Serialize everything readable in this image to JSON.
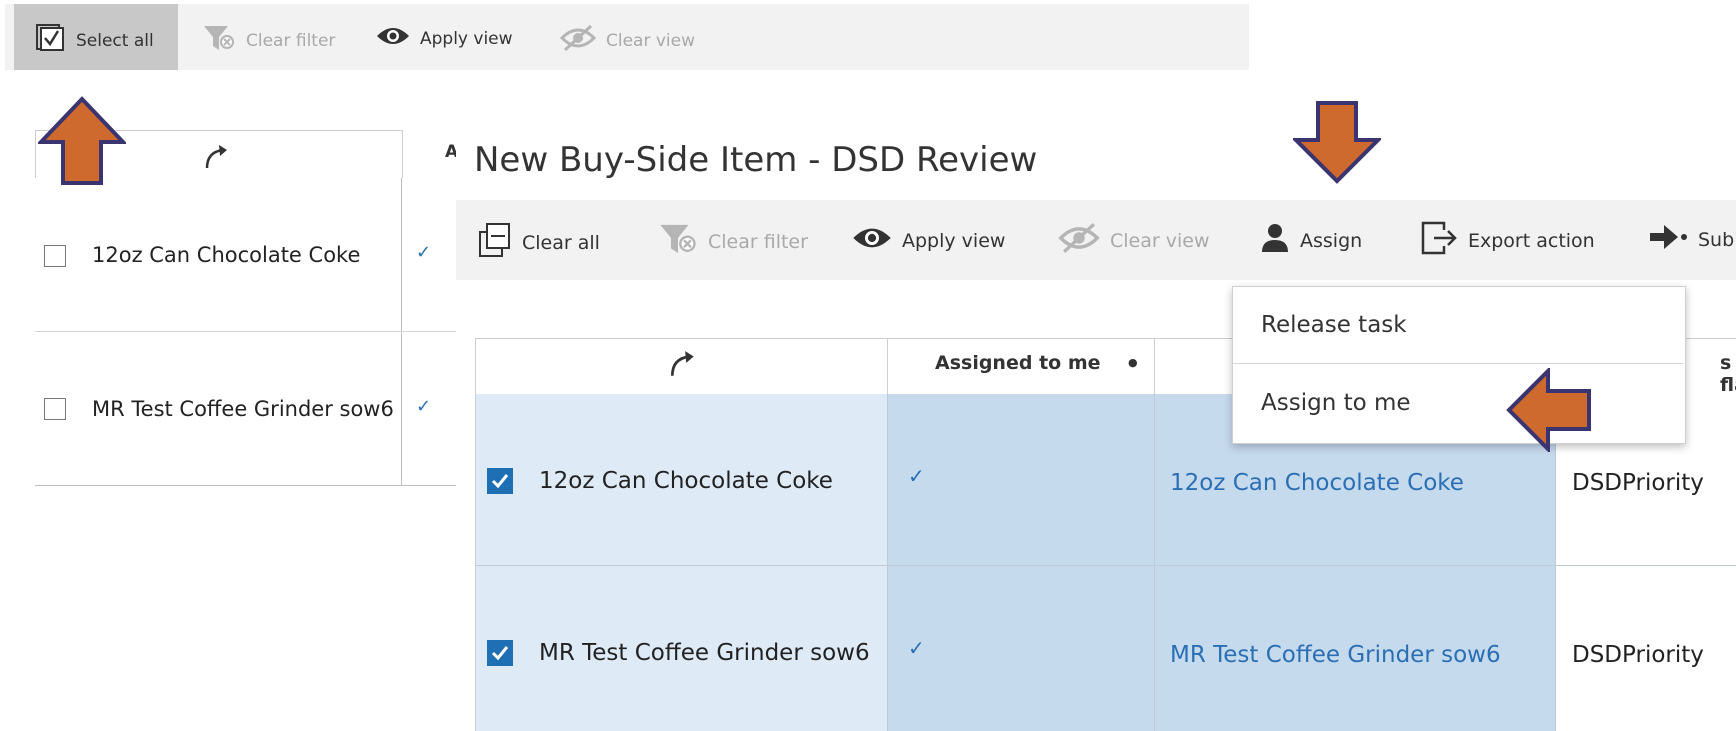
{
  "top_toolbar": {
    "select_all": "Select all",
    "clear_filter": "Clear filter",
    "apply_view": "Apply view",
    "clear_view": "Clear view"
  },
  "back_grid": {
    "header_partial": "A",
    "rows": [
      {
        "name": "12oz Can Chocolate Coke",
        "check": "✓"
      },
      {
        "name": "MR Test Coffee Grinder sow6",
        "check": "✓"
      }
    ]
  },
  "panel": {
    "title": "New Buy-Side Item - DSD Review",
    "toolbar": {
      "clear_all": "Clear all",
      "clear_filter": "Clear filter",
      "apply_view": "Apply view",
      "clear_view": "Clear view",
      "assign": "Assign",
      "export_action": "Export action",
      "submit_partial": "Sub"
    },
    "columns": {
      "assigned": "Assigned to me",
      "dot": "●",
      "flag_partial": "s flag"
    },
    "rows": [
      {
        "name": "12oz Can Chocolate Coke",
        "assigned": "✓",
        "item": "12oz Can Chocolate Coke",
        "flag": "DSDPriority"
      },
      {
        "name": "MR Test Coffee Grinder sow6",
        "assigned": "✓",
        "item": "MR Test Coffee Grinder sow6",
        "flag": "DSDPriority"
      }
    ]
  },
  "assign_menu": {
    "items": [
      "Release task",
      "Assign to me"
    ]
  },
  "colors": {
    "arrow_fill": "#cf6a2e",
    "arrow_stroke": "#3a3470",
    "row_bg": "#deeaf6",
    "assigned_bg": "#c6daee",
    "link": "#2a6fb3"
  }
}
